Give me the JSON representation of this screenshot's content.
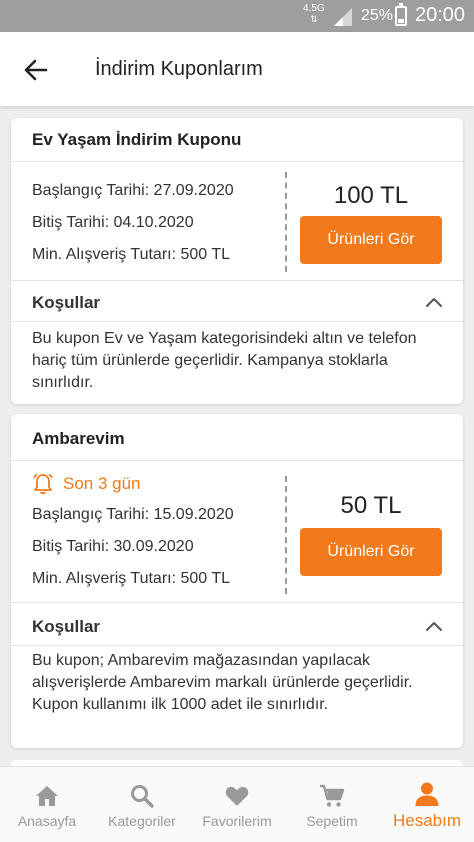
{
  "status_bar": {
    "network": "4.5G",
    "battery_percent": "25%",
    "battery_level": 0.25,
    "time": "20:00"
  },
  "app_bar": {
    "title": "İndirim Kuponlarım",
    "back_icon": "arrow-left-icon"
  },
  "coupons": [
    {
      "title": "Ev Yaşam İndirim Kuponu",
      "start": "Başlangıç Tarihi: 27.09.2020",
      "end": "Bitiş Tarihi: 04.10.2020",
      "min": "Min. Alışveriş Tutarı: 500 TL",
      "amount": "100 TL",
      "button": "Ürünleri Gör",
      "conditions_title": "Koşullar",
      "conditions_text": "Bu kupon Ev ve Yaşam kategorisindeki altın ve telefon hariç tüm ürünlerde geçerlidir. Kampanya stoklarla sınırlıdır."
    },
    {
      "title": "Ambarevim",
      "urgency": "Son 3 gün",
      "start": "Başlangıç Tarihi: 15.09.2020",
      "end": "Bitiş Tarihi: 30.09.2020",
      "min": "Min. Alışveriş Tutarı: 500 TL",
      "amount": "50 TL",
      "button": "Ürünleri Gör",
      "conditions_title": "Koşullar",
      "conditions_text": "Bu kupon; Ambarevim mağazasından yapılacak alışverişlerde Ambarevim markalı ürünlerde geçerlidir. Kupon kullanımı ilk 1000 adet ile sınırlıdır."
    }
  ],
  "bottom_nav": [
    {
      "label": "Anasayfa",
      "icon": "home-icon"
    },
    {
      "label": "Kategoriler",
      "icon": "search-icon"
    },
    {
      "label": "Favorilerim",
      "icon": "heart-icon"
    },
    {
      "label": "Sepetim",
      "icon": "cart-icon"
    },
    {
      "label": "Hesabım",
      "icon": "user-icon",
      "active": true
    }
  ],
  "colors": {
    "accent": "#f27a1a",
    "status_bar": "#9e9e9e",
    "background": "#eeeeee",
    "nav_inactive": "#999999"
  }
}
